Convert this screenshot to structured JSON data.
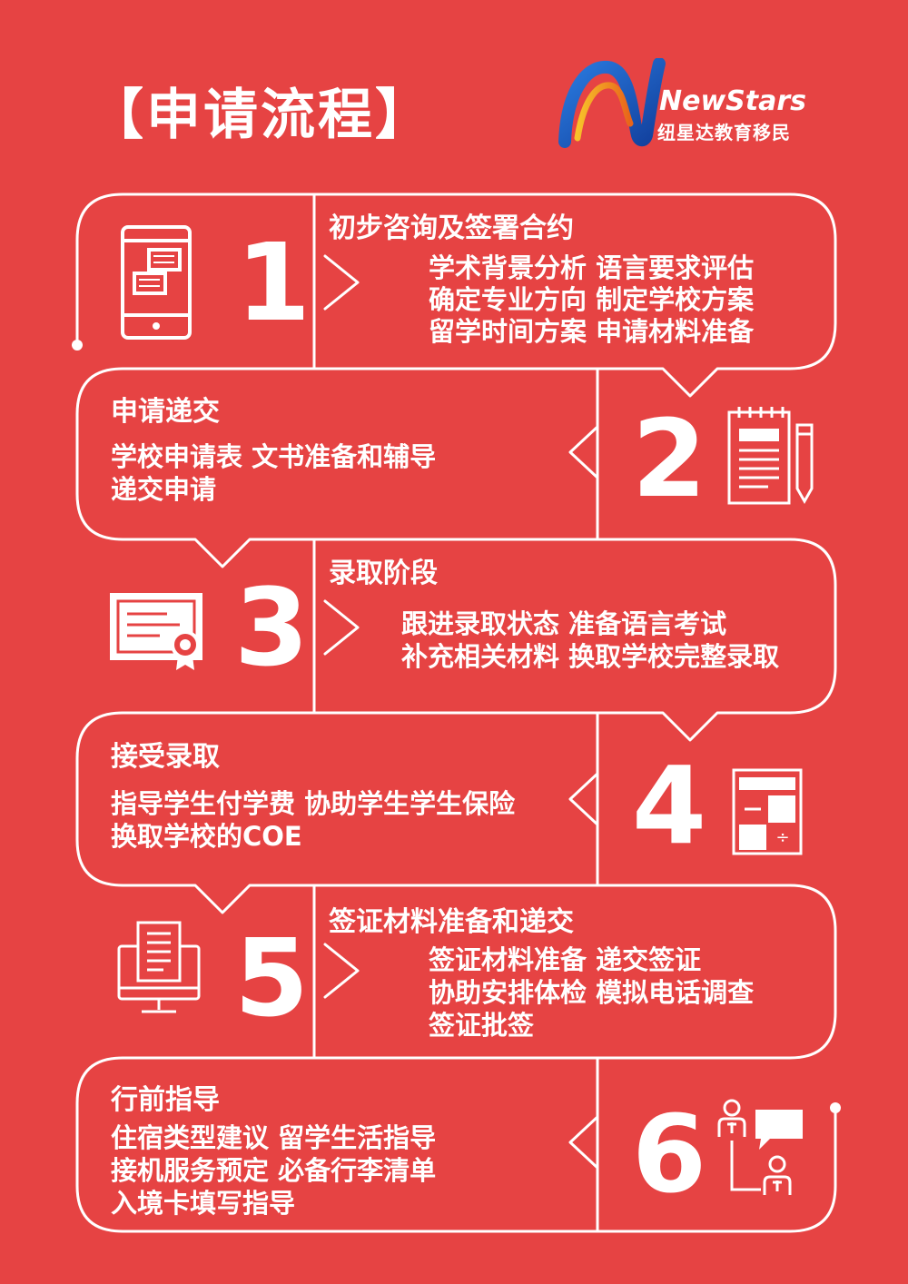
{
  "page": {
    "title": "【申请流程】"
  },
  "logo": {
    "name": "NewStars",
    "subtitle": "纽星达教育移民"
  },
  "steps": [
    {
      "number": "1",
      "title": "初步咨询及签署合约",
      "lines": [
        "学术背景分析  语言要求评估",
        "确定专业方向  制定学校方案",
        "留学时间方案  申请材料准备"
      ],
      "icon": "tablet-icon"
    },
    {
      "number": "2",
      "title": "申请递交",
      "lines": [
        "学校申请表  文书准备和辅导",
        "递交申请"
      ],
      "icon": "notepad-pencil-icon"
    },
    {
      "number": "3",
      "title": "录取阶段",
      "lines": [
        "跟进录取状态  准备语言考试",
        "补充相关材料  换取学校完整录取"
      ],
      "icon": "certificate-icon"
    },
    {
      "number": "4",
      "title": "接受录取",
      "lines": [
        "指导学生付学费  协助学生学生保险",
        "换取学校的COE"
      ],
      "icon": "calculator-icon"
    },
    {
      "number": "5",
      "title": "签证材料准备和递交",
      "lines": [
        "签证材料准备  递交签证",
        "协助安排体检  模拟电话调查",
        "签证批签"
      ],
      "icon": "computer-document-icon"
    },
    {
      "number": "6",
      "title": "行前指导",
      "lines": [
        "住宿类型建议  留学生活指导",
        "接机服务预定  必备行李清单",
        "入境卡填写指导"
      ],
      "icon": "consultation-icon"
    }
  ],
  "colors": {
    "background": "#e64343",
    "foreground": "#ffffff",
    "logo_blue": "#1f5fc4",
    "logo_orange": "#f4a21a"
  }
}
